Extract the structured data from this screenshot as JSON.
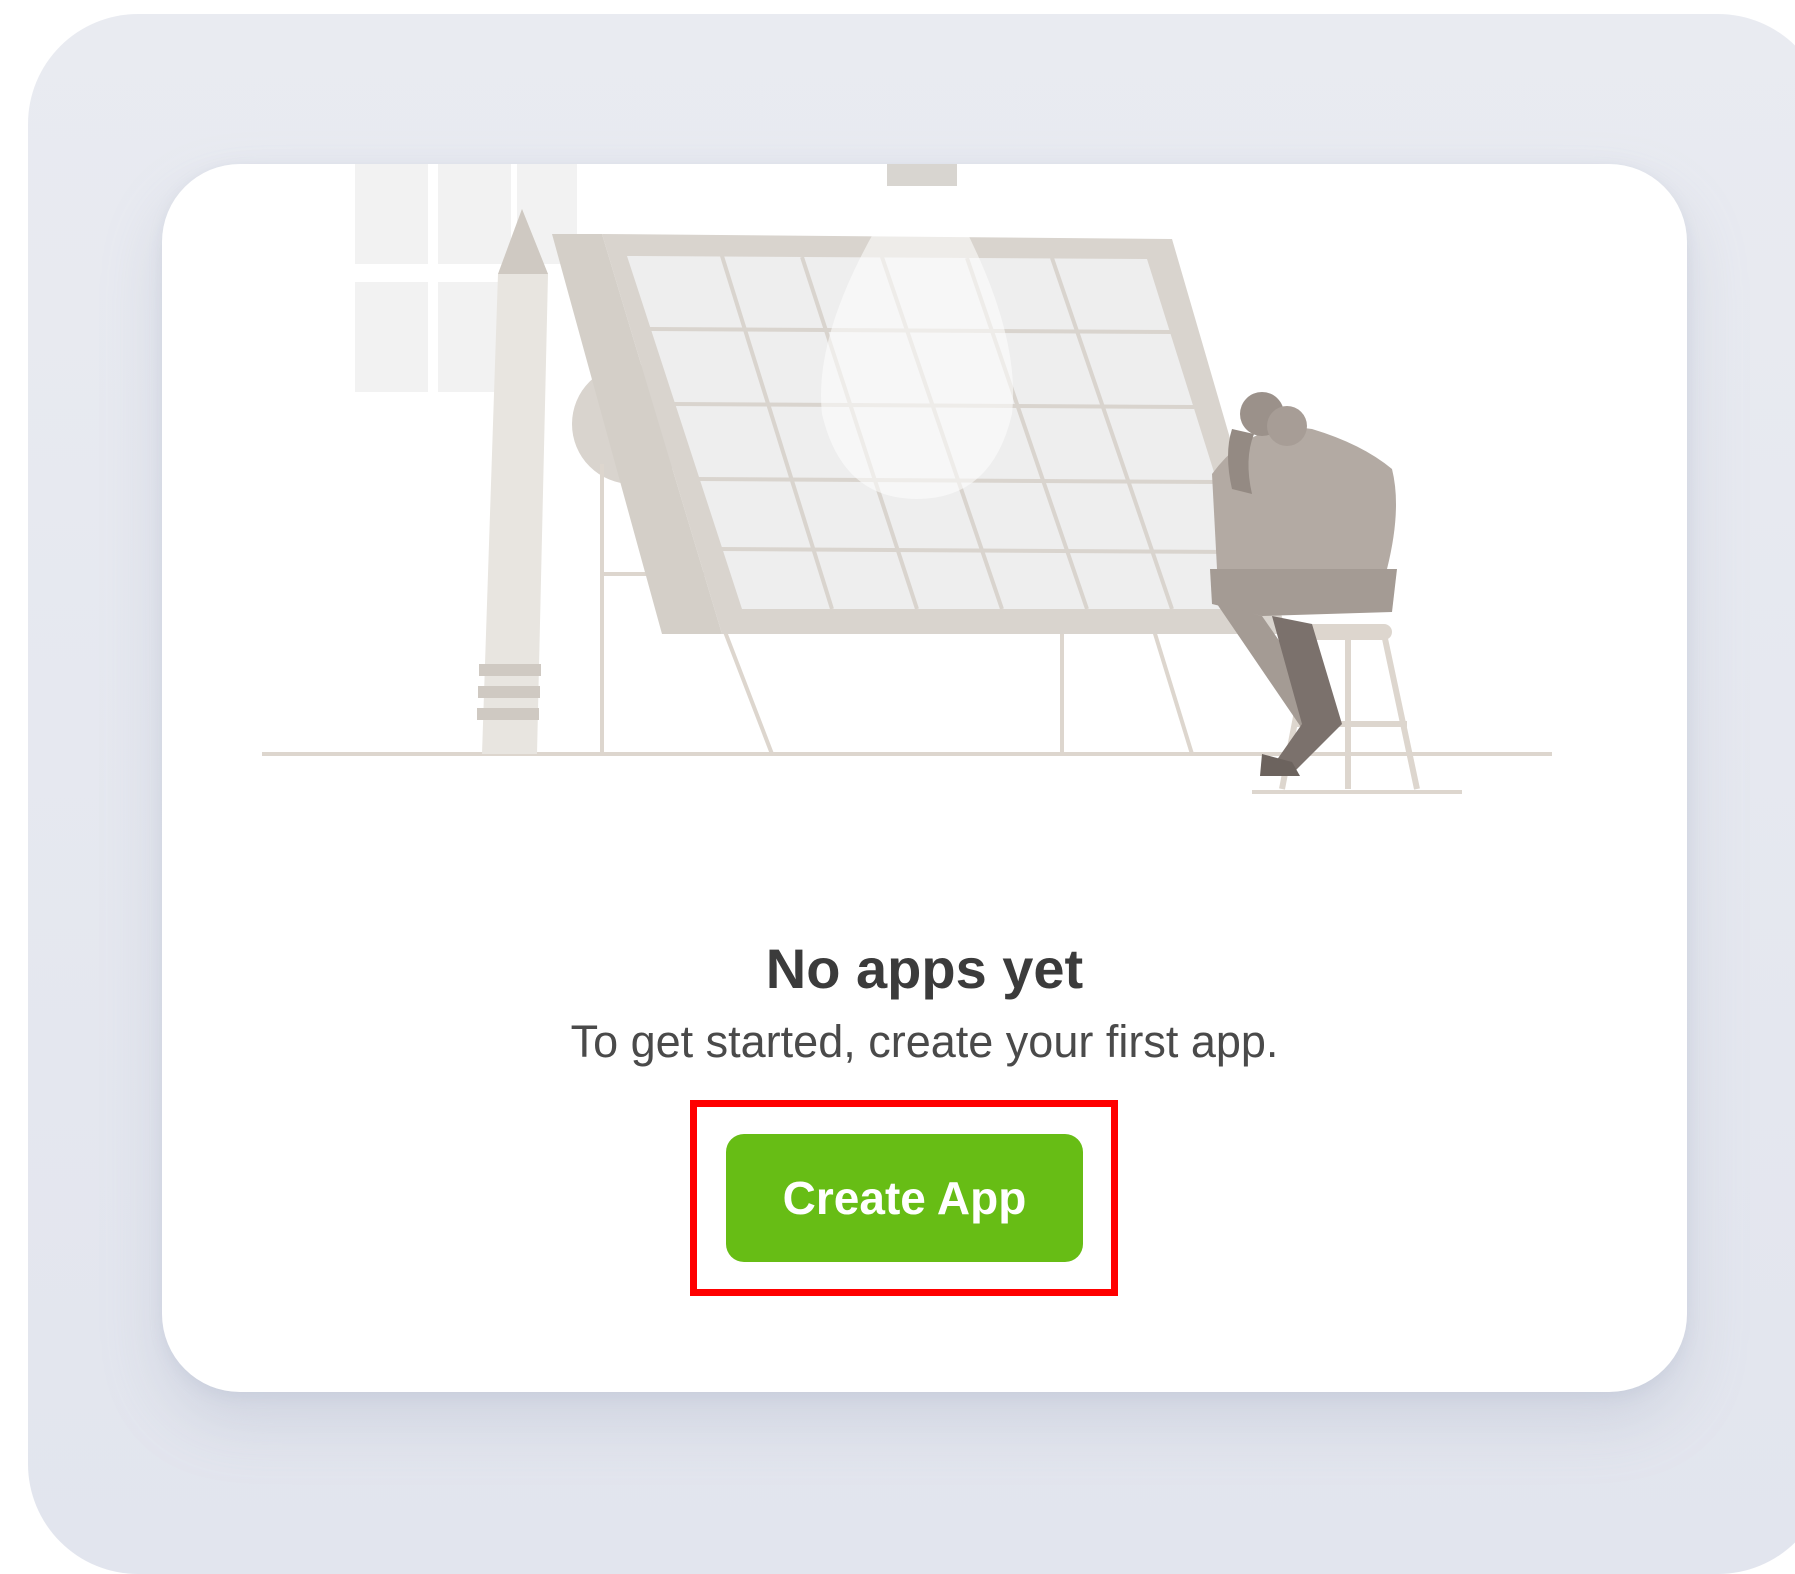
{
  "empty_state": {
    "title": "No apps yet",
    "subtitle": "To get started, create your first app.",
    "illustration_icon": "drafting-table-illustration"
  },
  "actions": {
    "create_app_label": "Create App"
  },
  "colors": {
    "primary_button": "#67bd15",
    "highlight": "#ff0000",
    "card_background": "#ffffff",
    "frame_background": "#e5e8ef"
  }
}
